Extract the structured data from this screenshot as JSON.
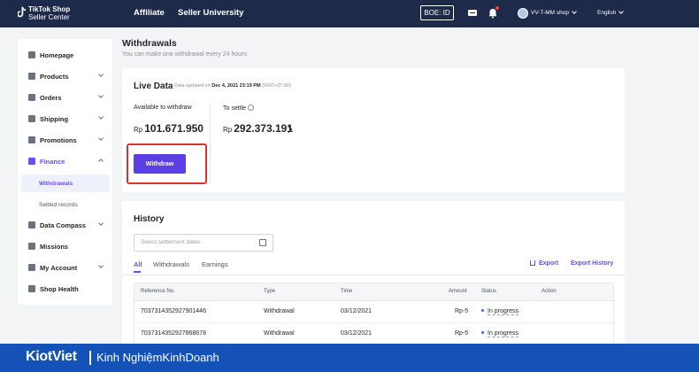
{
  "topbar": {
    "logo_title": "TikTok Shop",
    "logo_sub": "Seller Center",
    "nav": [
      "Affiliate",
      "Seller University"
    ],
    "boe": "BOE: ID",
    "shop_name": "VV-T-MM shop",
    "language": "English"
  },
  "sidebar": {
    "items": [
      {
        "label": "Homepage",
        "icon": "home-icon"
      },
      {
        "label": "Products",
        "icon": "products-icon"
      },
      {
        "label": "Orders",
        "icon": "orders-icon"
      },
      {
        "label": "Shipping",
        "icon": "truck-icon"
      },
      {
        "label": "Promotions",
        "icon": "megaphone-icon"
      },
      {
        "label": "Finance",
        "icon": "finance-icon"
      },
      {
        "label": "Data Compass",
        "icon": "chart-icon"
      },
      {
        "label": "Missions",
        "icon": "medal-icon"
      },
      {
        "label": "My Account",
        "icon": "user-icon"
      },
      {
        "label": "Shop Health",
        "icon": "shield-icon"
      }
    ],
    "finance_sub": [
      "Withdrawals",
      "Settled records"
    ]
  },
  "page": {
    "title": "Withdrawals",
    "subtitle": "You can make one withdrawal every 24 hours"
  },
  "live": {
    "title": "Live Data",
    "updated_prefix": "Data updated on",
    "updated_date": "Dec 4, 2021 23:19 PM",
    "updated_tz": "(GMT+07:00)",
    "available_label": "Available to withdraw",
    "currency": "Rp",
    "available_amount": "101.671.950",
    "settle_label": "To settle",
    "settle_amount": "292.373.191",
    "withdraw_button": "Withdraw"
  },
  "history": {
    "title": "History",
    "date_placeholder": "Select settlement dates",
    "tabs": [
      "All",
      "Withdrawals",
      "Earnings"
    ],
    "export": "Export",
    "export_history": "Export History",
    "columns": [
      "Reference No.",
      "Type",
      "Time",
      "Amount",
      "Status",
      "Action"
    ],
    "rows": [
      {
        "ref": "7037314352927901446",
        "type": "Withdrawal",
        "time": "03/12/2021",
        "amount": "Rp-5",
        "status": "In progress"
      },
      {
        "ref": "7037314352927868678",
        "type": "Withdrawal",
        "time": "03/12/2021",
        "amount": "Rp-5",
        "status": "In progress"
      }
    ]
  },
  "watermark": {
    "brand": "KiotViet",
    "text": "Kinh NghiệmKinhDoanh"
  },
  "colors": {
    "topbar": "#1d2a4a",
    "accent": "#5b3fe4",
    "highlight": "#e0322d",
    "watermark": "#1452b8"
  }
}
